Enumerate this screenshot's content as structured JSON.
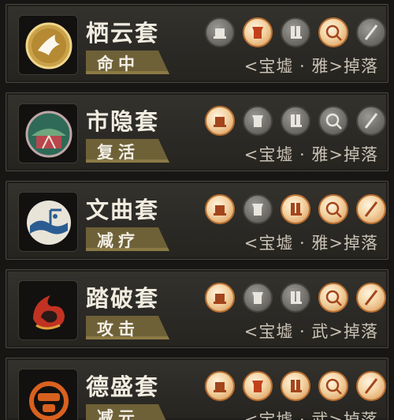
{
  "sets": [
    {
      "name": "栖云套",
      "effect": "命中",
      "drop": "<宝墟 · 雅>掉落",
      "emblem": "white-bird-gold-disc-icon",
      "slots": [
        "dim",
        "lit",
        "dim",
        "lit",
        "dim"
      ]
    },
    {
      "name": "市隐套",
      "effect": "复活",
      "drop": "<宝墟 · 雅>掉落",
      "emblem": "city-gate-green-disc-icon",
      "slots": [
        "lit",
        "dim",
        "dim",
        "dim",
        "dim"
      ]
    },
    {
      "name": "文曲套",
      "effect": "减疗",
      "drop": "<宝墟 · 雅>掉落",
      "emblem": "blue-wave-scroll-icon",
      "slots": [
        "lit",
        "dim",
        "lit",
        "lit",
        "lit"
      ]
    },
    {
      "name": "踏破套",
      "effect": "攻击",
      "drop": "<宝墟 · 武>掉落",
      "emblem": "red-flame-bird-icon",
      "slots": [
        "lit",
        "dim",
        "dim",
        "lit",
        "lit"
      ]
    },
    {
      "name": "德盛套",
      "effect": "减元",
      "drop": "<宝墟 · 武>掉落",
      "emblem": "orange-coin-emblem-icon",
      "slots": [
        "lit",
        "lit",
        "lit",
        "lit",
        "lit"
      ]
    }
  ],
  "slot_icons": [
    "hat-icon",
    "robe-icon",
    "boots-icon",
    "pendant-icon",
    "blade-icon"
  ],
  "colors": {
    "lit_slot": "#f3d3a3",
    "dim_slot": "#76746f",
    "plate": "#7a6a3e",
    "card": "#2f2d29"
  }
}
